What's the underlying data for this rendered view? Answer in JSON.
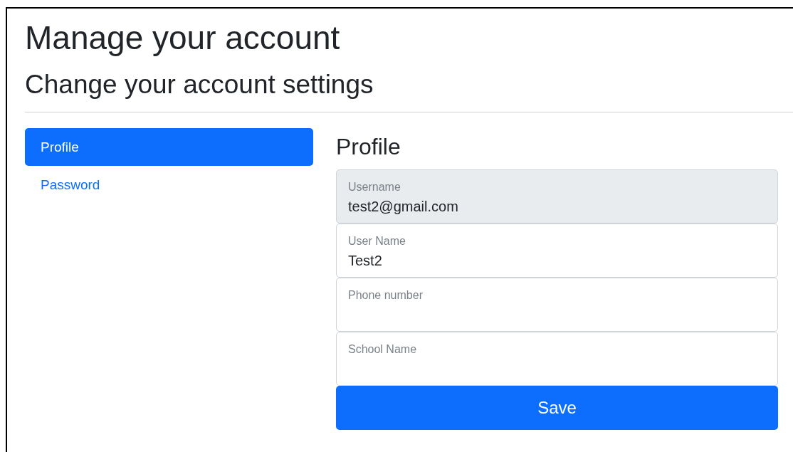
{
  "title": "Manage your account",
  "subtitle": "Change your account settings",
  "nav": [
    {
      "label": "Profile",
      "selected": true
    },
    {
      "label": "Password",
      "selected": false
    }
  ],
  "section_title": "Profile",
  "fields": [
    {
      "label": "Username",
      "value": "test2@gmail.com",
      "disabled": true
    },
    {
      "label": "User Name",
      "value": "Test2",
      "disabled": false
    },
    {
      "label": "Phone number",
      "disabled": false
    },
    {
      "label": "School Name",
      "disabled": false
    }
  ],
  "save_button": "Save"
}
